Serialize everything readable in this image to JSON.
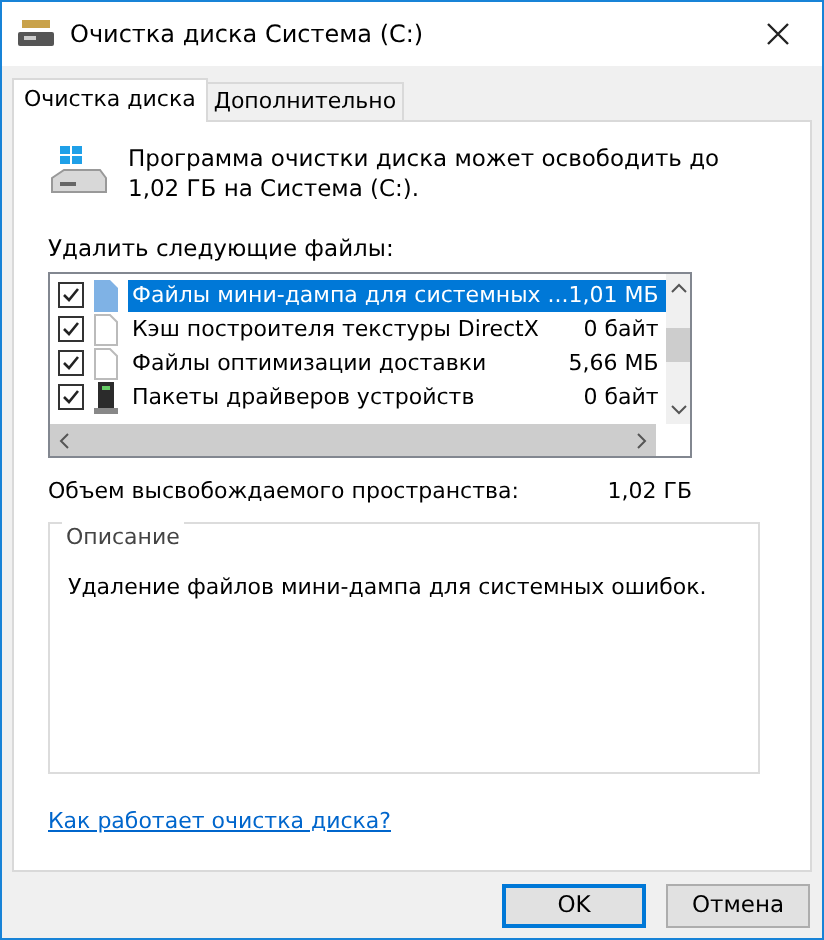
{
  "window": {
    "title": "Очистка диска Система (C:)"
  },
  "tabs": [
    {
      "label": "Очистка диска",
      "selected": true
    },
    {
      "label": "Дополнительно",
      "selected": false
    }
  ],
  "intro": "Программа очистки диска может освободить до 1,02 ГБ на Система (C:).",
  "files_label": "Удалить следующие файлы:",
  "files": [
    {
      "name": "Файлы мини-дампа для системных ...",
      "size": "1,01 МБ",
      "checked": true,
      "selected": true,
      "kind": "doc-blue"
    },
    {
      "name": "Кэш построителя текстуры DirectX",
      "size": "0 байт",
      "checked": true,
      "selected": false,
      "kind": "doc"
    },
    {
      "name": "Файлы оптимизации доставки",
      "size": "5,66 МБ",
      "checked": true,
      "selected": false,
      "kind": "doc"
    },
    {
      "name": "Пакеты драйверов устройств",
      "size": "0 байт",
      "checked": true,
      "selected": false,
      "kind": "driver"
    }
  ],
  "total": {
    "label": "Объем высвобождаемого пространства:",
    "value": "1,02 ГБ"
  },
  "description": {
    "title": "Описание",
    "text": "Удаление файлов мини-дампа для системных ошибок."
  },
  "help_link": "Как работает очистка диска?",
  "buttons": [
    {
      "label": "OK",
      "kind": "default"
    },
    {
      "label": "Отмена",
      "kind": "normal"
    }
  ]
}
